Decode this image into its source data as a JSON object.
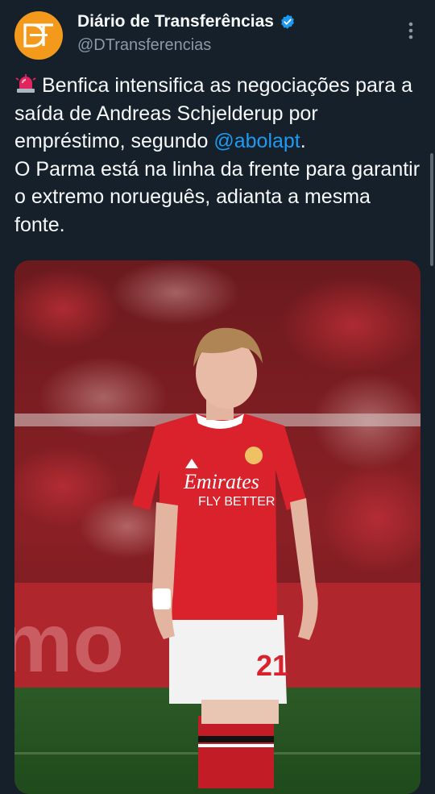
{
  "author": {
    "display_name": "Diário de Transferências",
    "handle": "@DTransferencias",
    "avatar_monogram": "DT",
    "avatar_color": "#f39a1d",
    "verified": true
  },
  "tweet": {
    "siren_icon": "rotating-light-icon",
    "line1_text": "Benfica intensifica as negociações para a saída de Andreas Schjelderup por empréstimo, segundo ",
    "mention": "@abolapt",
    "line1_end": ".",
    "line2_text": "O Parma está na linha da frente para garantir o extremo norueguês, adianta a mesma fonte."
  },
  "media": {
    "kind": "photo",
    "shirt_sponsor_line1": "Emirates",
    "shirt_sponsor_line2": "FLY BETTER",
    "shirt_number": "21",
    "board_text": "mo"
  },
  "colors": {
    "background": "#15202b",
    "link": "#1d9bf0",
    "secondary_text": "#8b98a5",
    "primary_text": "#f7f9f9"
  }
}
